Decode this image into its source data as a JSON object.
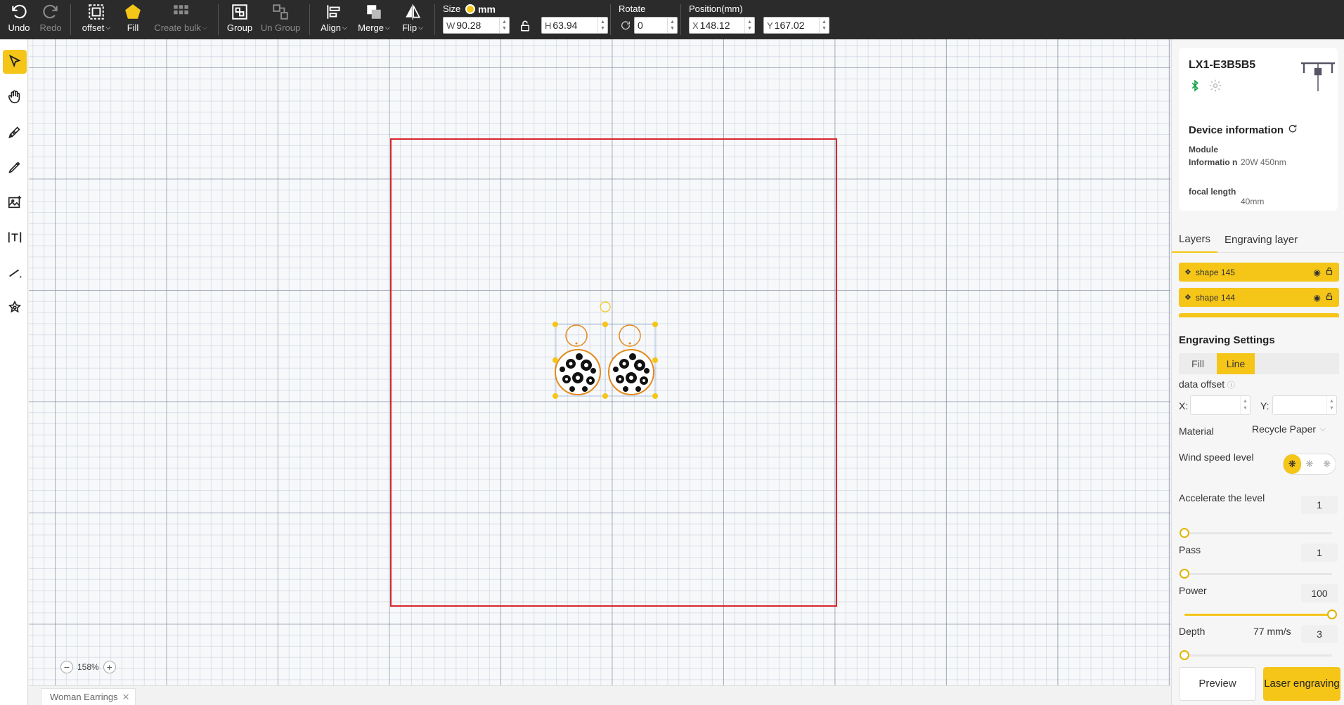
{
  "toolbar": {
    "undo": "Undo",
    "redo": "Redo",
    "offset": "offset",
    "fill": "Fill",
    "create_bulk": "Create bulk",
    "group": "Group",
    "ungroup": "Un Group",
    "align": "Align",
    "merge": "Merge",
    "flip": "Flip",
    "size_label": "Size",
    "unit": "mm",
    "width_prefix": "W",
    "width": "90.28",
    "height_prefix": "H",
    "height": "63.94",
    "rotate_label": "Rotate",
    "rotate": "0",
    "position_label": "Position(mm)",
    "x_prefix": "X",
    "x": "148.12",
    "y_prefix": "Y",
    "y": "167.02"
  },
  "canvas": {
    "zoom": "158%",
    "file_tab": "Woman Earrings"
  },
  "device": {
    "name": "LX1-E3B5B5",
    "info_title": "Device information",
    "module_label": "Module Informatio n",
    "module_value": "20W 450nm",
    "focal_label": "focal length",
    "focal_value": "40mm"
  },
  "tabs": {
    "layers": "Layers",
    "engraving_layer": "Engraving layer"
  },
  "layers": [
    {
      "name": "shape 145"
    },
    {
      "name": "shape 144"
    }
  ],
  "settings": {
    "title": "Engraving Settings",
    "mode_fill": "Fill",
    "mode_line": "Line",
    "data_offset": "data offset",
    "x_label": "X:",
    "y_label": "Y:",
    "material_label": "Material",
    "material_value": "Recycle Paper",
    "wind_label": "Wind speed level",
    "accel_label": "Accelerate the level",
    "accel_value": "1",
    "pass_label": "Pass",
    "pass_value": "1",
    "power_label": "Power",
    "power_value": "100",
    "depth_label": "Depth",
    "speed_value": "77 mm/s",
    "depth_value": "3",
    "accel_fraction": 0,
    "pass_fraction": 0,
    "power_fraction": 1.0,
    "depth_fraction": 0
  },
  "buttons": {
    "preview": "Preview",
    "laser": "Laser engraving"
  },
  "colors": {
    "accent": "#f5c518",
    "work_area_border": "#d8262d",
    "toolbar_bg": "#2b2b2b",
    "bluetooth": "#1aa34a"
  }
}
